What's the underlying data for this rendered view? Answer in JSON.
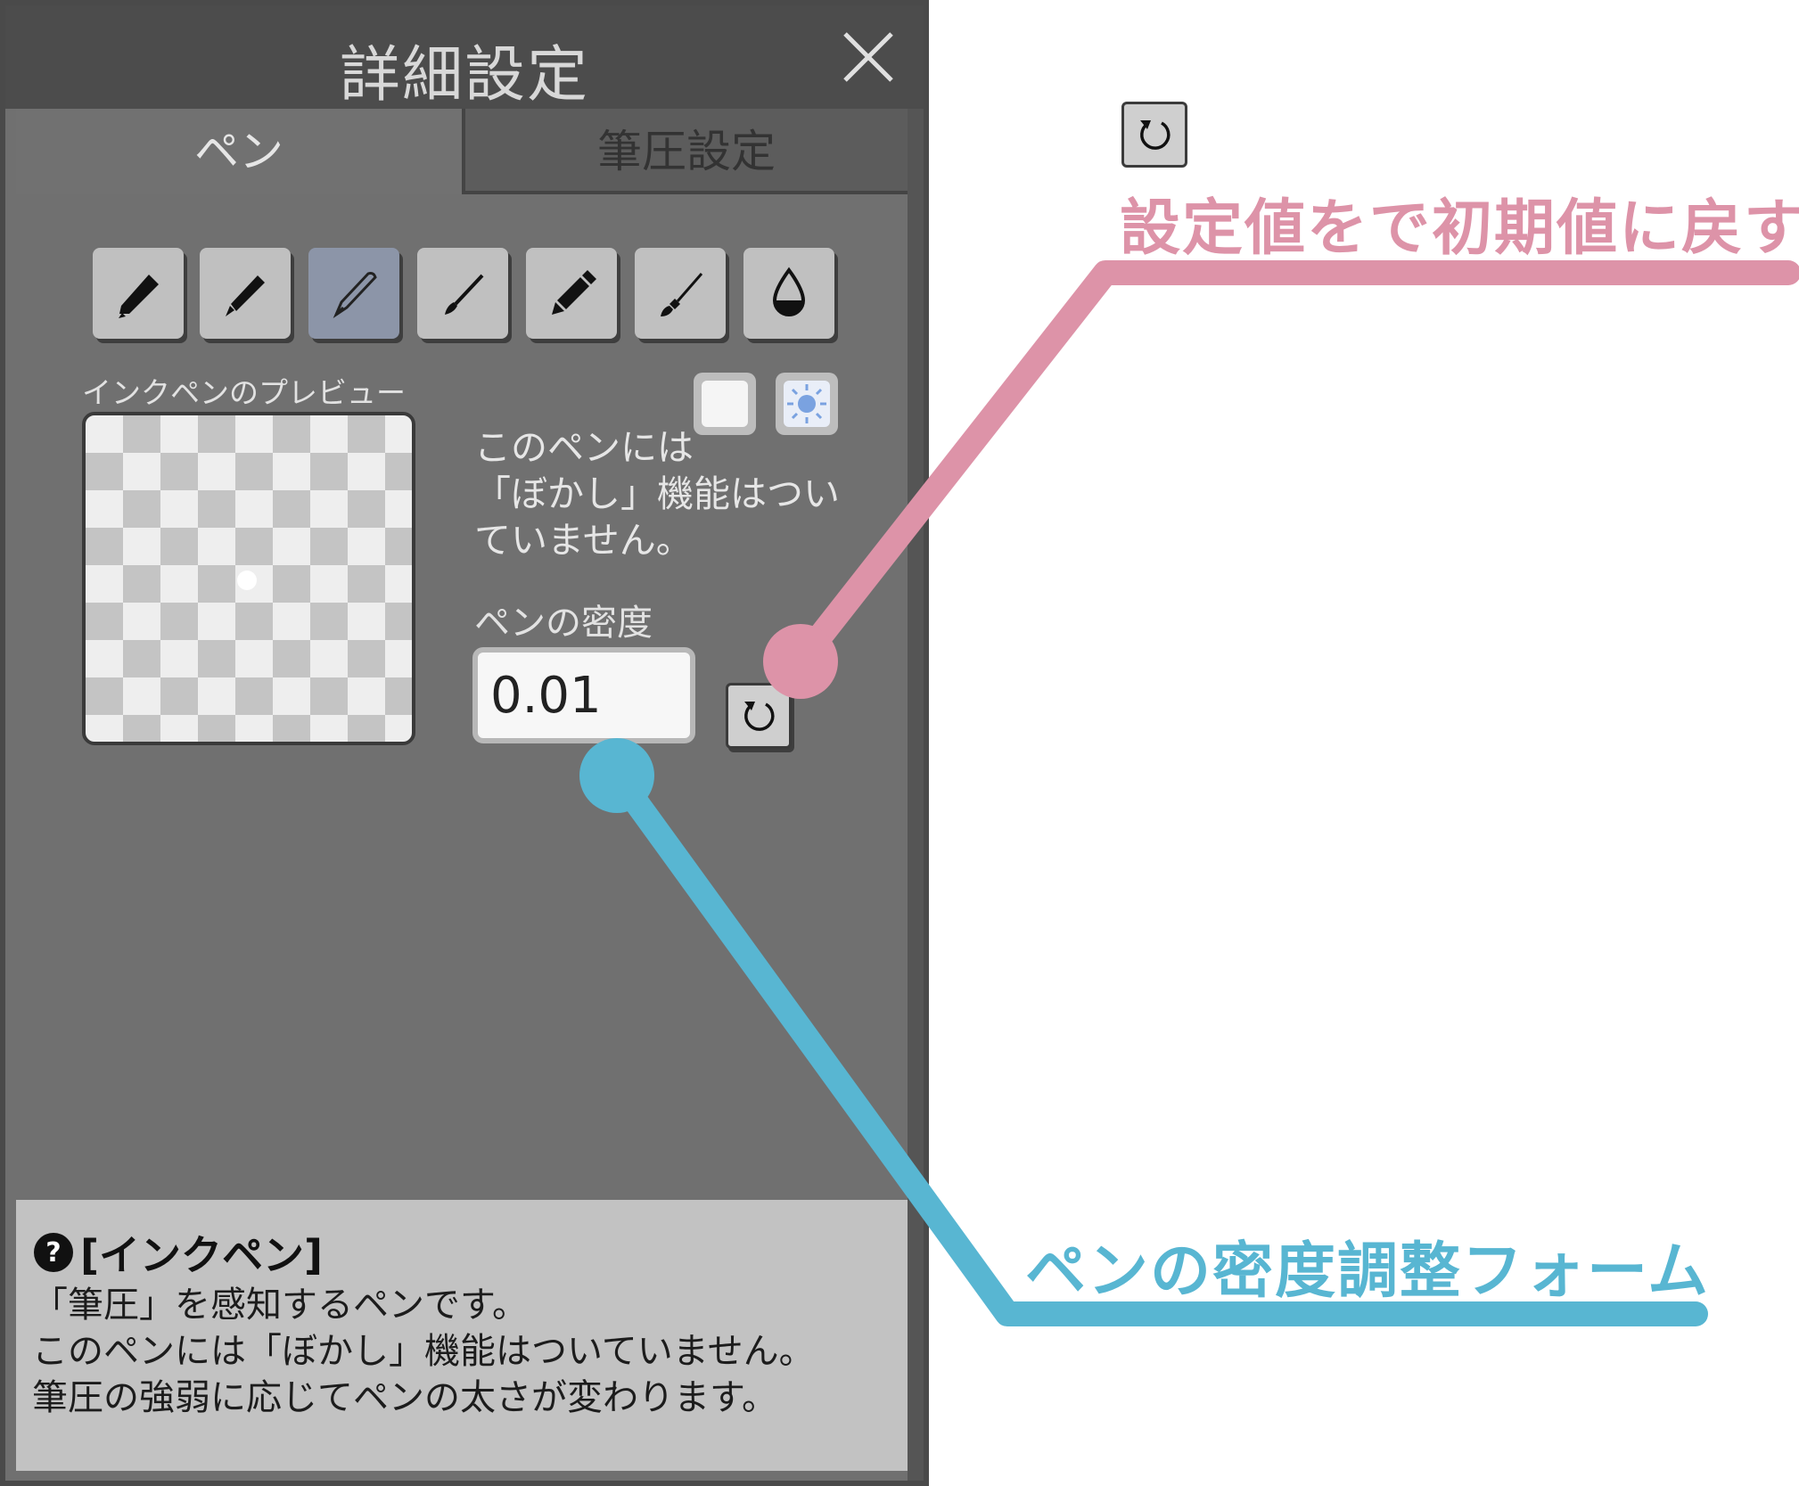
{
  "dialog": {
    "title": "詳細設定",
    "tabs": [
      {
        "label": "ペン",
        "active": true
      },
      {
        "label": "筆圧設定",
        "active": false
      }
    ]
  },
  "tools": [
    {
      "icon": "marker-pen-icon"
    },
    {
      "icon": "felt-pen-icon"
    },
    {
      "icon": "ink-pen-icon",
      "selected": true
    },
    {
      "icon": "brush-pen-icon"
    },
    {
      "icon": "pencil-icon"
    },
    {
      "icon": "paint-brush-icon"
    },
    {
      "icon": "ink-drop-icon"
    }
  ],
  "preview": {
    "label": "インクペンのプレビュー"
  },
  "background_buttons": [
    {
      "icon": "white-square-icon"
    },
    {
      "icon": "sun-icon"
    }
  ],
  "note": {
    "line1": "このペンには",
    "line2": "「ぼかし」機能はつい",
    "line3": "ていません。"
  },
  "density": {
    "label": "ペンの密度",
    "value": "0.01"
  },
  "help": {
    "title": "[インクペン]",
    "line1": "「筆圧」を感知するペンです。",
    "line2": "このペンには「ぼかし」機能はついていません。",
    "line3": "筆圧の強弱に応じてペンの太さが変わります。"
  },
  "annotations": {
    "reset_label": "設定値をで初期値に戻す",
    "density_label": "ペンの密度調整フォーム",
    "pink_color": "#dd93a8",
    "blue_color": "#58b6d2"
  }
}
